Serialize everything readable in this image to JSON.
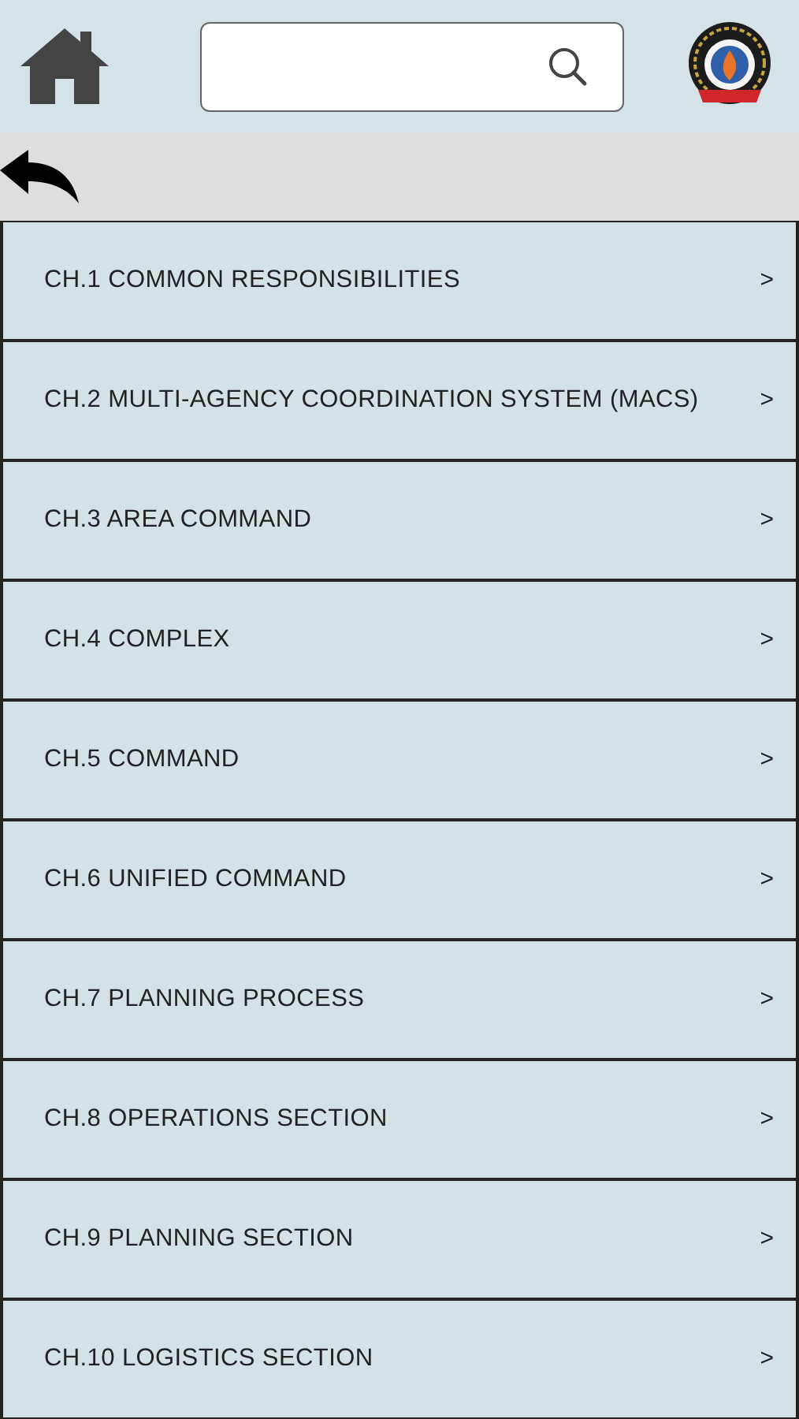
{
  "chapters": [
    {
      "title": "CH.1 COMMON RESPONSIBILITIES",
      "chevron": ">"
    },
    {
      "title": "CH.2 MULTI-AGENCY COORDINATION SYSTEM (MACS)",
      "chevron": ">"
    },
    {
      "title": "CH.3 AREA COMMAND",
      "chevron": ">"
    },
    {
      "title": "CH.4 COMPLEX",
      "chevron": ">"
    },
    {
      "title": "CH.5 COMMAND",
      "chevron": ">"
    },
    {
      "title": "CH.6 UNIFIED COMMAND",
      "chevron": ">"
    },
    {
      "title": "CH.7 PLANNING PROCESS",
      "chevron": ">"
    },
    {
      "title": "CH.8 OPERATIONS SECTION",
      "chevron": ">"
    },
    {
      "title": "CH.9 PLANNING SECTION",
      "chevron": ">"
    },
    {
      "title": "CH.10 LOGISTICS SECTION",
      "chevron": ">"
    }
  ]
}
